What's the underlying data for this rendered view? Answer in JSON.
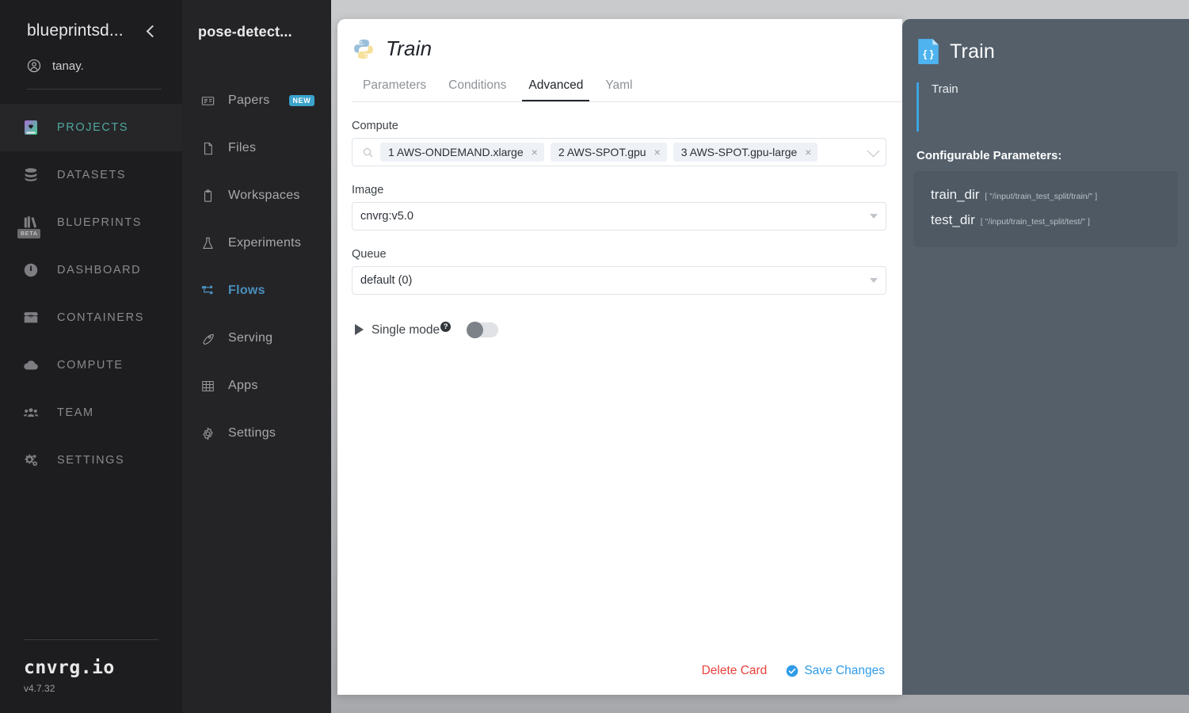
{
  "sidebar": {
    "org_name": "blueprintsd...",
    "user_name": "tanay.",
    "collapse_icon": "chevron-left-icon",
    "items": [
      {
        "label": "PROJECTS",
        "icon": "book-heart-icon",
        "active": true
      },
      {
        "label": "DATASETS",
        "icon": "database-icon",
        "active": false
      },
      {
        "label": "BLUEPRINTS",
        "icon": "books-icon",
        "badge": "BETA",
        "active": false
      },
      {
        "label": "DASHBOARD",
        "icon": "gauge-icon",
        "active": false
      },
      {
        "label": "CONTAINERS",
        "icon": "box-icon",
        "active": false
      },
      {
        "label": "COMPUTE",
        "icon": "cloud-icon",
        "active": false
      },
      {
        "label": "TEAM",
        "icon": "people-icon",
        "active": false
      },
      {
        "label": "SETTINGS",
        "icon": "gears-icon",
        "active": false
      }
    ],
    "brand": "cnvrg.io",
    "version": "v4.7.32"
  },
  "project_nav": {
    "title": "pose-detect...",
    "items": [
      {
        "label": "Papers",
        "icon": "paper-icon",
        "badge": "NEW",
        "active": false
      },
      {
        "label": "Files",
        "icon": "file-icon",
        "active": false
      },
      {
        "label": "Workspaces",
        "icon": "clipboard-icon",
        "active": false
      },
      {
        "label": "Experiments",
        "icon": "flask-icon",
        "active": false
      },
      {
        "label": "Flows",
        "icon": "flow-icon",
        "active": true
      },
      {
        "label": "Serving",
        "icon": "rocket-icon",
        "active": false
      },
      {
        "label": "Apps",
        "icon": "grid-icon",
        "active": false
      },
      {
        "label": "Settings",
        "icon": "gear-icon",
        "active": false
      }
    ]
  },
  "card": {
    "title": "Train",
    "icon": "python-icon",
    "tabs": [
      {
        "label": "Parameters",
        "active": false
      },
      {
        "label": "Conditions",
        "active": false
      },
      {
        "label": "Advanced",
        "active": true
      },
      {
        "label": "Yaml",
        "active": false
      }
    ],
    "compute": {
      "label": "Compute",
      "search_icon": "search-icon",
      "chips": [
        "1 AWS-ONDEMAND.xlarge",
        "2 AWS-SPOT.gpu",
        "3 AWS-SPOT.gpu-large"
      ],
      "remove_glyph": "×"
    },
    "image": {
      "label": "Image",
      "value": "cnvrg:v5.0"
    },
    "queue": {
      "label": "Queue",
      "value": "default (0)"
    },
    "single_mode": {
      "label": "Single mode",
      "help_glyph": "?",
      "enabled": false
    },
    "footer": {
      "delete_label": "Delete Card",
      "save_label": "Save Changes",
      "save_icon": "check-circle-icon"
    }
  },
  "panel": {
    "icon": "json-file-icon",
    "title": "Train",
    "subtitle": "Train",
    "params_title": "Configurable Parameters:",
    "params": [
      {
        "name": "train_dir",
        "default": "[ \"/input/train_test_split/train/\" ]"
      },
      {
        "name": "test_dir",
        "default": "[ \"/input/train_test_split/test/\" ]"
      }
    ]
  },
  "colors": {
    "accent_blue": "#3ba3e0",
    "active_teal": "#4fa79f",
    "flows_blue": "#4a8fbd",
    "danger_red": "#e8413c",
    "save_blue": "#2f9ce8",
    "panel_slate": "#545f6a"
  }
}
